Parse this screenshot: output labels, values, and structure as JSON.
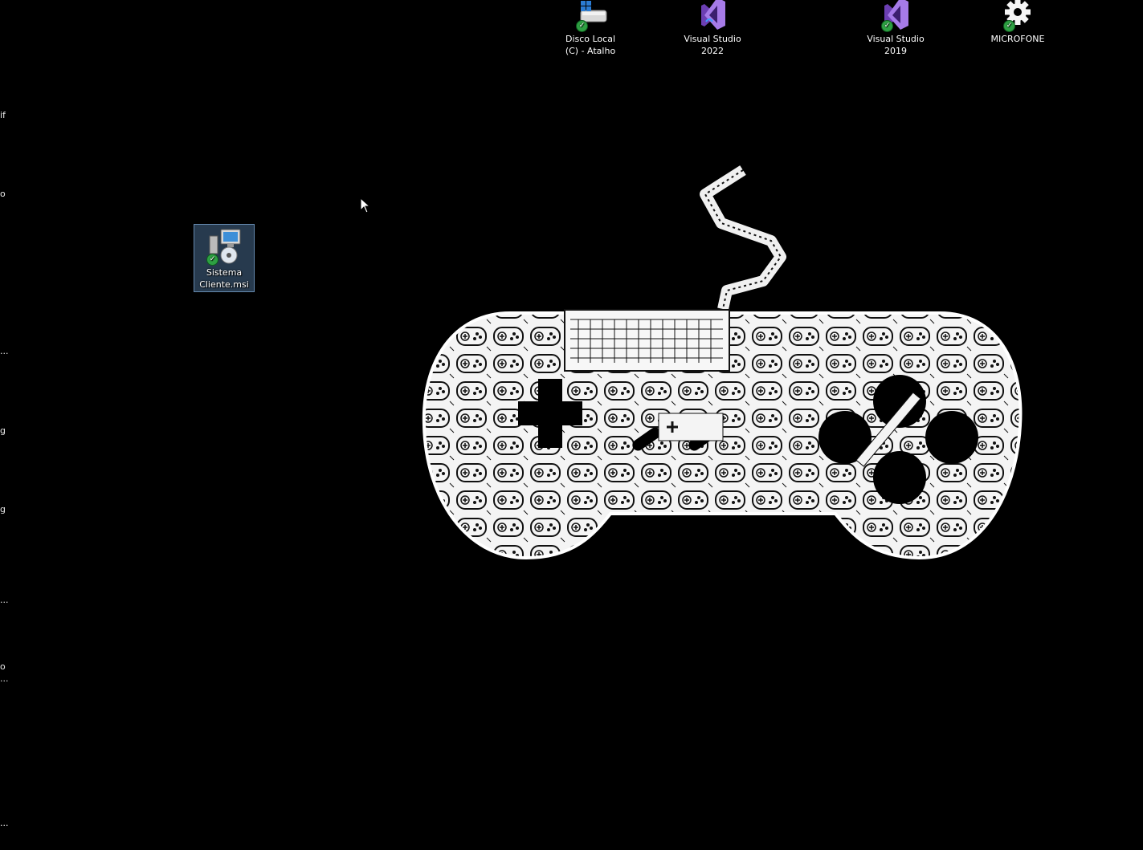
{
  "desktop": {
    "icons": [
      {
        "label_line1": "Disco Local",
        "label_line2": "(C) - Atalho",
        "icon": "drive-shortcut-icon"
      },
      {
        "label_line1": "Visual Studio",
        "label_line2": "2022",
        "icon": "visual-studio-2022-icon"
      },
      {
        "label_line1": "Visual Studio",
        "label_line2": "2019",
        "icon": "visual-studio-2019-icon"
      },
      {
        "label_line1": "MICROFONE",
        "label_line2": "",
        "icon": "gear-icon"
      },
      {
        "label_line1": "Sistema",
        "label_line2": "Cliente.msi",
        "icon": "msi-installer-icon",
        "selected": true
      }
    ],
    "left_edge_fragments": [
      "if",
      "o",
      "...",
      "g",
      "g",
      "...",
      "o",
      "...",
      "..."
    ],
    "wallpaper": "gamepad-collage-wallpaper",
    "colors": {
      "background": "#000000",
      "selection": "#6699cc",
      "sync_check": "#2ea043",
      "vs_purple": "#865fc5"
    }
  }
}
